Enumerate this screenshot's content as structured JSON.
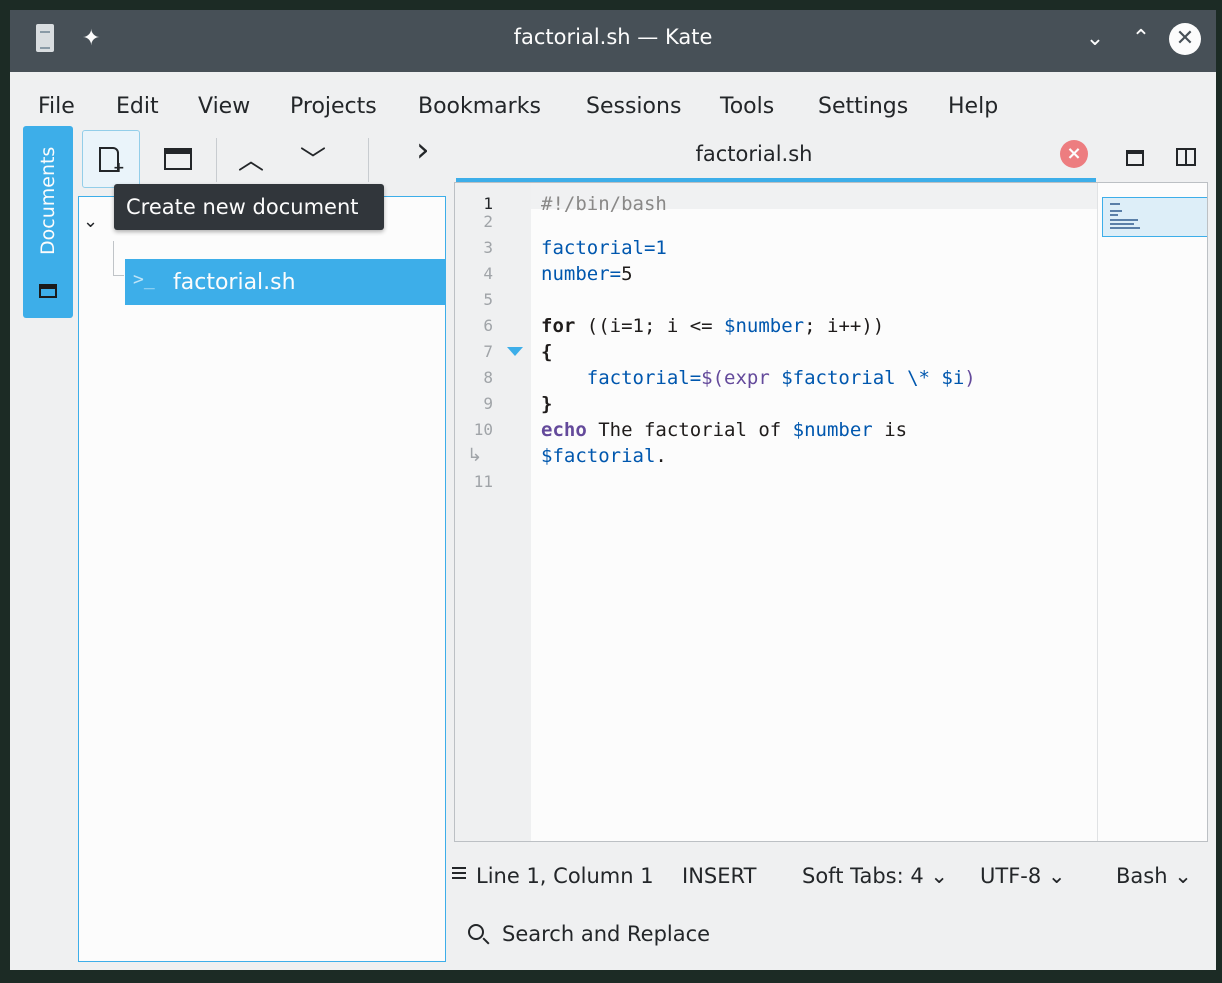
{
  "window": {
    "title": "factorial.sh — Kate"
  },
  "titlebar": {
    "minimize_glyph": "⌄",
    "maximize_glyph": "⌃",
    "close_glyph": "✕"
  },
  "menu": [
    {
      "label": "File"
    },
    {
      "label": "Edit"
    },
    {
      "label": "View"
    },
    {
      "label": "Projects"
    },
    {
      "label": "Bookmarks"
    },
    {
      "label": "Sessions"
    },
    {
      "label": "Tools"
    },
    {
      "label": "Settings"
    },
    {
      "label": "Help"
    }
  ],
  "sidebar": {
    "tab_label": "Documents"
  },
  "doc_toolbar": {
    "prev_glyph": "︿",
    "next_glyph": "﹀",
    "more_glyph": "›"
  },
  "tooltip": {
    "text": "Create new document"
  },
  "documents": [
    {
      "name": "factorial.sh",
      "icon": "terminal-icon",
      "selected": true
    }
  ],
  "tab": {
    "label": "factorial.sh"
  },
  "editor": {
    "lines": [
      {
        "n": "1"
      },
      {
        "n": "2"
      },
      {
        "n": "3"
      },
      {
        "n": "4"
      },
      {
        "n": "5"
      },
      {
        "n": "6"
      },
      {
        "n": "7"
      },
      {
        "n": "8"
      },
      {
        "n": "9"
      },
      {
        "n": "10"
      },
      {
        "n": "11"
      }
    ],
    "code": {
      "l1": "#!/bin/bash",
      "l3": "factorial=1",
      "l4a": "number=",
      "l4b": "5",
      "l6_for": "for",
      "l6_open": " ((i=1; i <= ",
      "l6_var": "$number",
      "l6_close": "; i++))",
      "l7": "{",
      "l8_assign": "    factorial=",
      "l8_subst": "$(expr ",
      "l8_var": "$factorial",
      "l8_op": " \\* ",
      "l8_var2": "$i",
      "l8_end": ")",
      "l9": "}",
      "l10_echo": "echo",
      "l10_text": " The factorial of ",
      "l10_var": "$number",
      "l10_is": " is",
      "l10b_var": "$factorial",
      "l10b_dot": "."
    }
  },
  "statusbar": {
    "position": "Line 1, Column 1",
    "mode": "INSERT",
    "indent": "Soft Tabs: 4",
    "encoding": "UTF-8",
    "language": "Bash"
  },
  "search": {
    "label": "Search and Replace"
  },
  "colors": {
    "accent": "#3daee9",
    "titlebar": "#475057",
    "tooltip": "#31363b",
    "close_tab": "#ed7d80"
  }
}
